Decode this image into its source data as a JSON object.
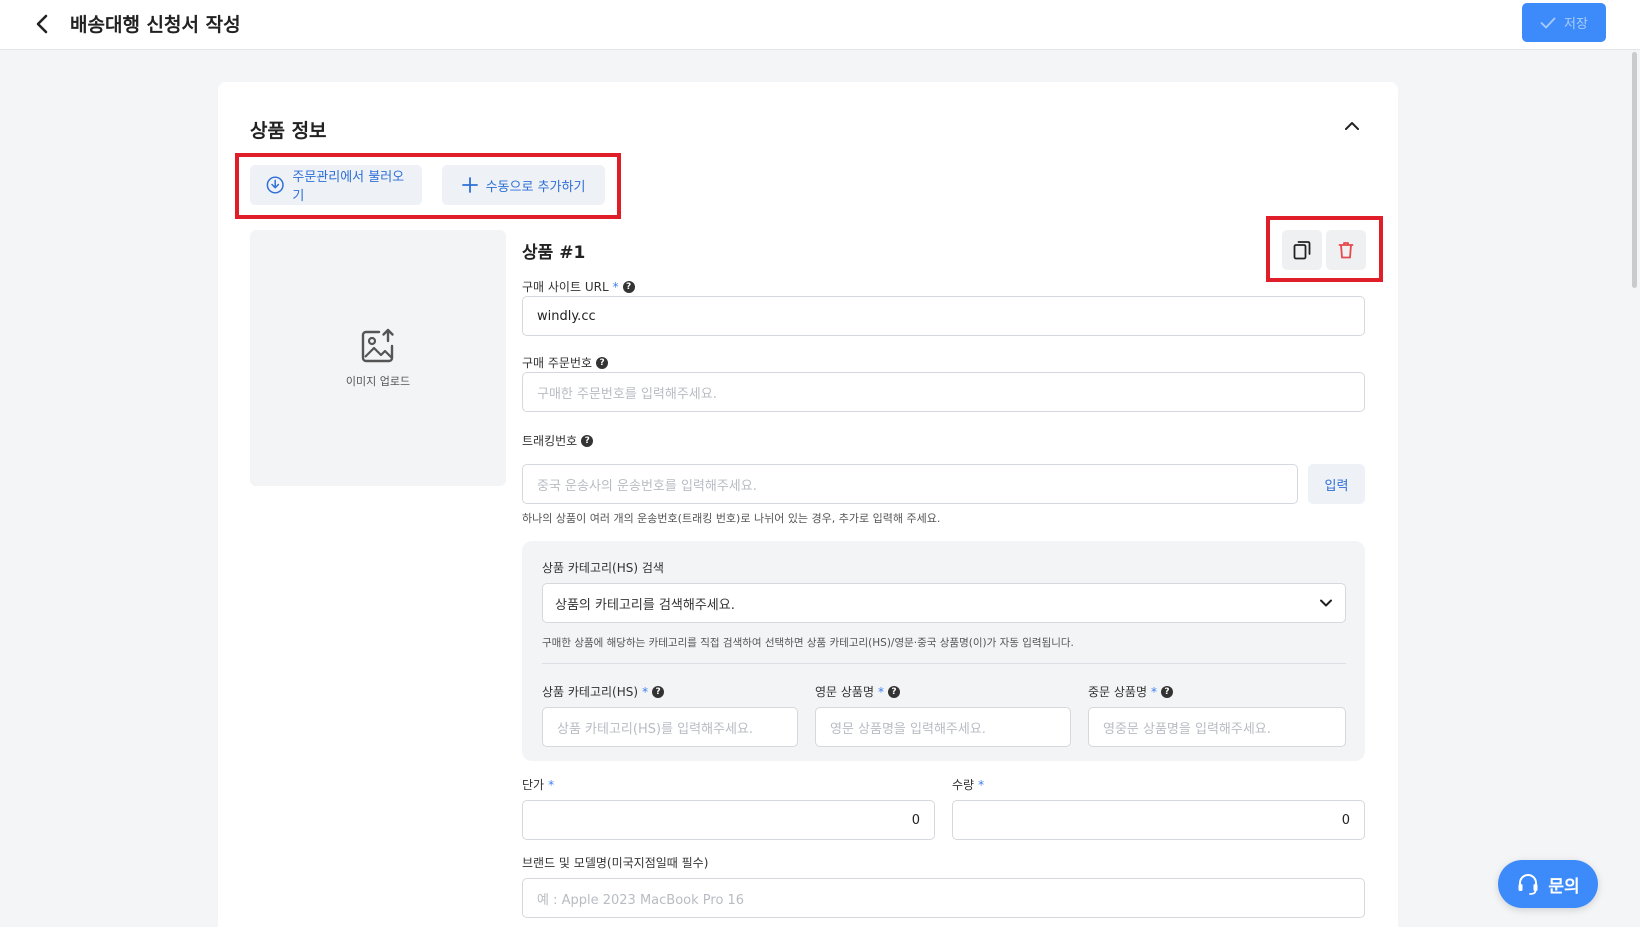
{
  "header": {
    "title": "배송대행 신청서 작성",
    "save_label": "저장"
  },
  "product_section": {
    "title": "상품 정보",
    "import_button": "주문관리에서 불러오기",
    "manual_button": "수동으로 추가하기",
    "image_upload_label": "이미지 업로드",
    "item_title": "상품 #1",
    "purchase_url": {
      "label": "구매 사이트 URL",
      "value": "windly.cc"
    },
    "order_number": {
      "label": "구매 주문번호",
      "placeholder": "구매한 주문번호를 입력해주세요."
    },
    "tracking": {
      "label": "트래킹번호",
      "placeholder": "중국 운송사의 운송번호를 입력해주세요.",
      "button": "입력",
      "hint": "하나의 상품이 여러 개의 운송번호(트래킹 번호)로 나뉘어 있는 경우, 추가로 입력해 주세요."
    },
    "hs_search": {
      "label": "상품 카테고리(HS) 검색",
      "placeholder": "상품의 카테고리를 검색해주세요.",
      "hint": "구매한 상품에 해당하는 카테고리를 직접 검색하여 선택하면 상품 카테고리(HS)/영문·중국 상품명(이)가 자동 입력됩니다."
    },
    "hs_category": {
      "label": "상품 카테고리(HS)",
      "placeholder": "상품 카테고리(HS)를 입력해주세요."
    },
    "english_name": {
      "label": "영문 상품명",
      "placeholder": "영문 상품명을 입력해주세요."
    },
    "chinese_name": {
      "label": "중문 상품명",
      "placeholder": "영중문 상품명을 입력해주세요."
    },
    "unit_price": {
      "label": "단가",
      "value": "0"
    },
    "quantity": {
      "label": "수량",
      "value": "0"
    },
    "brand_model": {
      "label": "브랜드 및 모델명(미국지점일때 필수)",
      "placeholder": "예 : Apple 2023 MacBook Pro 16"
    }
  },
  "inquiry_button": "문의",
  "colors": {
    "accent": "#3d8bfa",
    "highlight": "#e01e2a",
    "delete": "#e5484d"
  }
}
